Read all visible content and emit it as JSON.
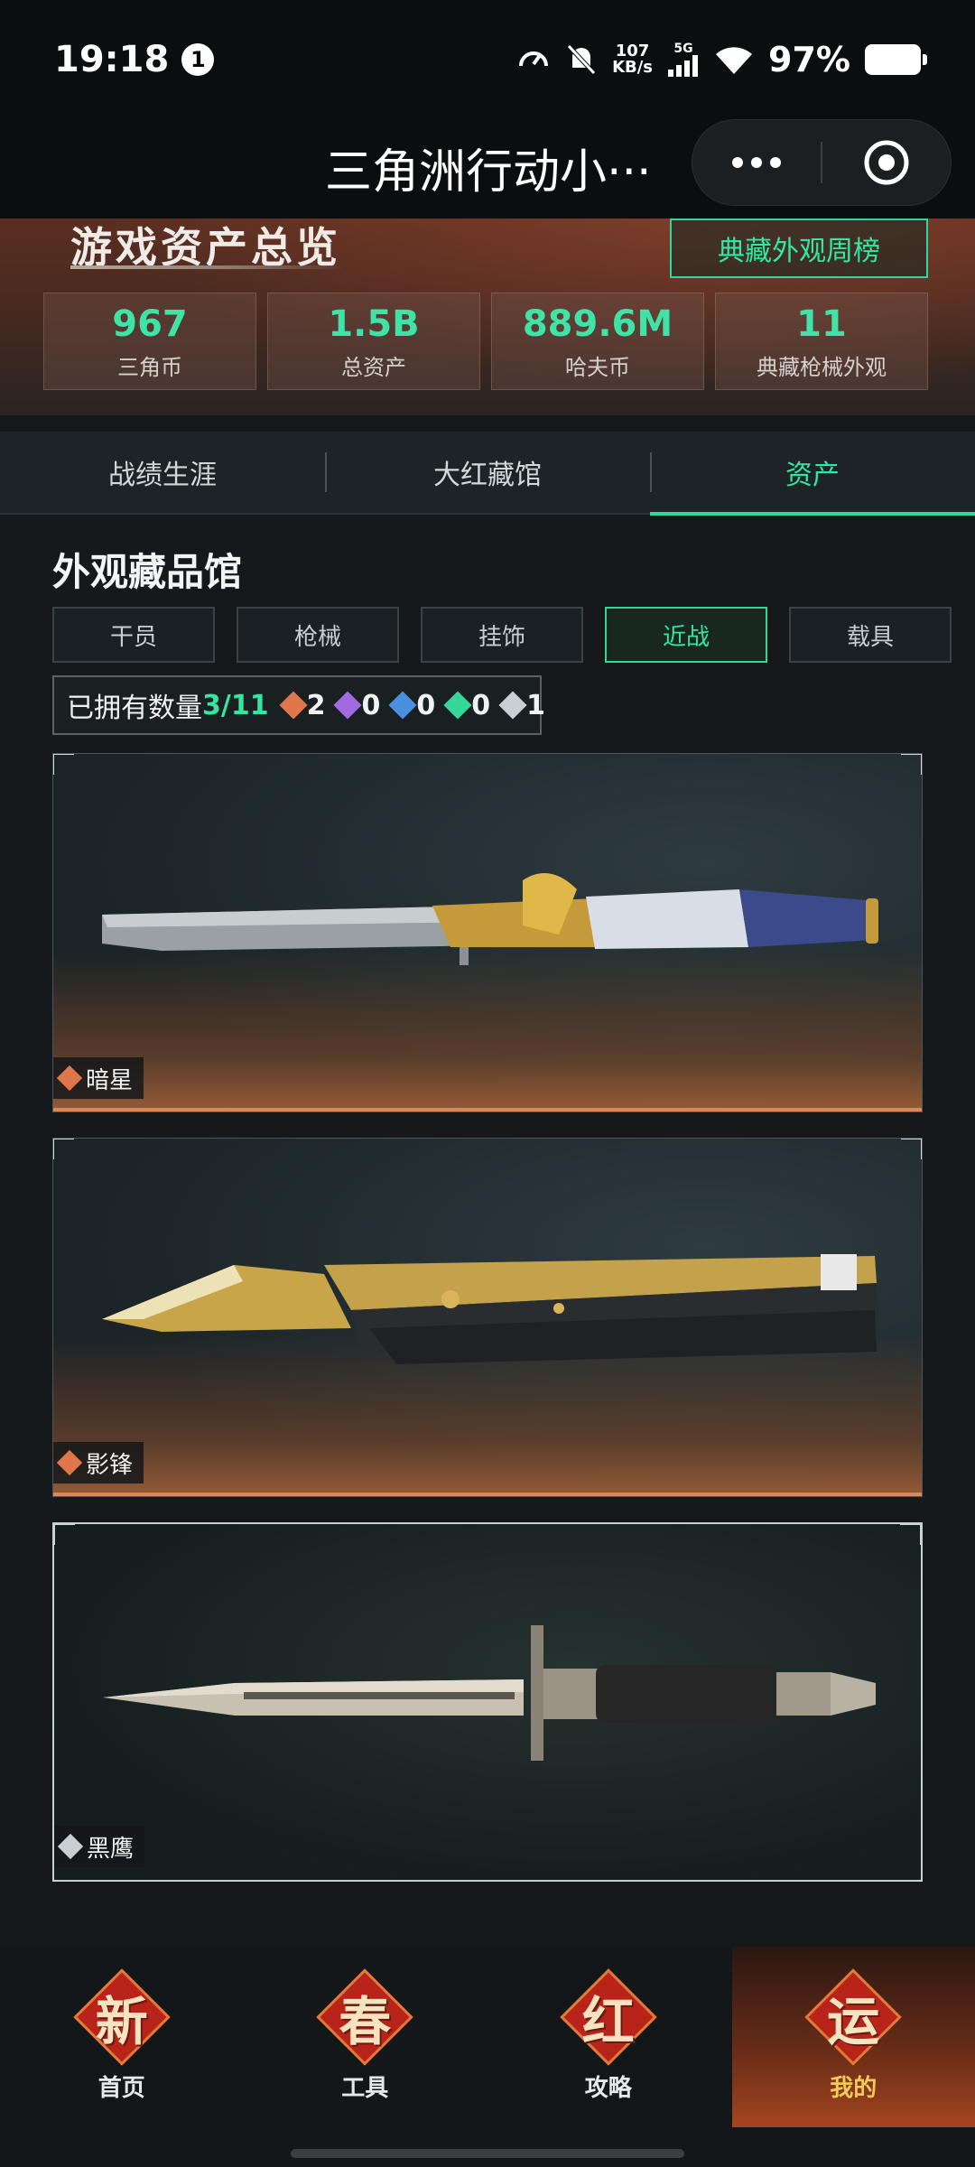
{
  "status_bar": {
    "time": "19:18",
    "notification_count": "1",
    "speed_value": "107",
    "speed_unit": "KB/s",
    "network": "5G",
    "battery": "97%"
  },
  "header": {
    "title": "三角洲行动小···"
  },
  "assets": {
    "title": "游戏资产总览",
    "rank_button": "典藏外观周榜",
    "stats": [
      {
        "value": "967",
        "label": "三角币"
      },
      {
        "value": "1.5B",
        "label": "总资产"
      },
      {
        "value": "889.6M",
        "label": "哈夫币"
      },
      {
        "value": "11",
        "label": "典藏枪械外观"
      }
    ]
  },
  "tabs": [
    {
      "label": "战绩生涯"
    },
    {
      "label": "大红藏馆"
    },
    {
      "label": "资产"
    }
  ],
  "collection": {
    "title": "外观藏品馆",
    "filters": [
      "干员",
      "枪械",
      "挂饰",
      "近战",
      "载具"
    ],
    "owned_label": "已拥有数量",
    "owned_count": "3/11",
    "rarity_counts": [
      {
        "value": "2",
        "color": "#e0774a"
      },
      {
        "value": "0",
        "color": "#a06be0"
      },
      {
        "value": "0",
        "color": "#4a8fe0"
      },
      {
        "value": "0",
        "color": "#35d69a"
      },
      {
        "value": "1",
        "color": "#c9cfd2"
      }
    ],
    "items": [
      {
        "name": "暗星",
        "rarity_color": "#e0774a"
      },
      {
        "name": "影锋",
        "rarity_color": "#e0774a"
      },
      {
        "name": "黑鹰",
        "rarity_color": "#c9cfd2"
      }
    ]
  },
  "bottom_nav": [
    {
      "badge": "新",
      "label": "首页"
    },
    {
      "badge": "春",
      "label": "工具"
    },
    {
      "badge": "红",
      "label": "攻略"
    },
    {
      "badge": "运",
      "label": "我的"
    }
  ],
  "colors": {
    "accent": "#34e6a2",
    "gold_rarity": "#e0774a"
  }
}
